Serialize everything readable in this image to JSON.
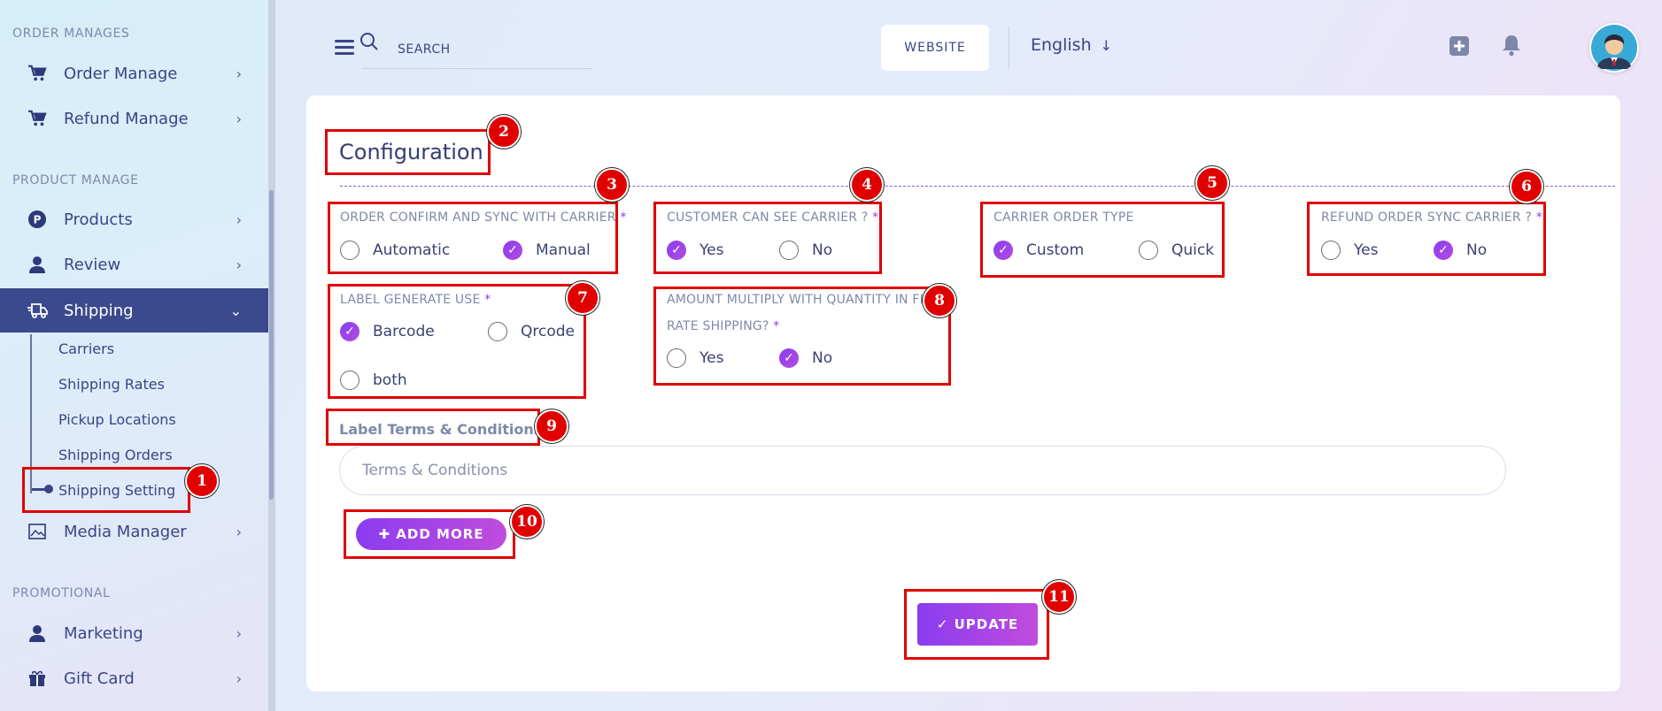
{
  "sidebar": {
    "sections": {
      "order": "ORDER MANAGES",
      "product": "PRODUCT MANAGE",
      "promotional": "PROMOTIONAL"
    },
    "items": {
      "order_manage": "Order Manage",
      "refund_manage": "Refund Manage",
      "products": "Products",
      "review": "Review",
      "shipping": "Shipping",
      "media_manager": "Media Manager",
      "marketing": "Marketing",
      "gift_card": "Gift Card"
    },
    "shipping_sub": {
      "carriers": "Carriers",
      "shipping_rates": "Shipping Rates",
      "pickup_locations": "Pickup Locations",
      "shipping_orders": "Shipping Orders",
      "shipping_setting": "Shipping Setting"
    },
    "chevron": "›",
    "chevron_open": "⌄"
  },
  "header": {
    "search_placeholder": "SEARCH",
    "website_label": "WEBSITE",
    "language": "English",
    "language_arrow": "↓"
  },
  "card": {
    "title": "Configuration",
    "fields": {
      "order_confirm": {
        "label": "ORDER CONFIRM AND SYNC WITH CARRIER",
        "required": "*",
        "options": [
          "Automatic",
          "Manual"
        ],
        "selected": "Manual"
      },
      "customer_see": {
        "label": "CUSTOMER CAN SEE CARRIER ?",
        "required": "*",
        "options": [
          "Yes",
          "No"
        ],
        "selected": "Yes"
      },
      "carrier_order_type": {
        "label": "CARRIER ORDER TYPE",
        "options": [
          "Custom",
          "Quick"
        ],
        "selected": "Custom"
      },
      "refund_sync": {
        "label": "REFUND ORDER SYNC CARRIER ?",
        "required": "*",
        "options": [
          "Yes",
          "No"
        ],
        "selected": "No"
      },
      "label_generate": {
        "label": "LABEL GENERATE USE",
        "required": "*",
        "options": [
          "Barcode",
          "Qrcode",
          "both"
        ],
        "selected": "Barcode"
      },
      "amount_multiply": {
        "label_line1": "AMOUNT MULTIPLY WITH QUANTITY IN FLAT",
        "label_line2": "RATE SHIPPING?",
        "required": "*",
        "options": [
          "Yes",
          "No"
        ],
        "selected": "No"
      }
    },
    "terms": {
      "label": "Label Terms & Conditions",
      "placeholder": "Terms & Conditions"
    },
    "add_more_label": "✚ ADD MORE",
    "update_label": "✓ UPDATE"
  },
  "annotations": [
    "1",
    "2",
    "3",
    "4",
    "5",
    "6",
    "7",
    "8",
    "9",
    "10",
    "11"
  ],
  "colors": {
    "accent": "#8a3cf0",
    "highlight": "#e00000",
    "sidebar_active": "#3b4a8d"
  }
}
